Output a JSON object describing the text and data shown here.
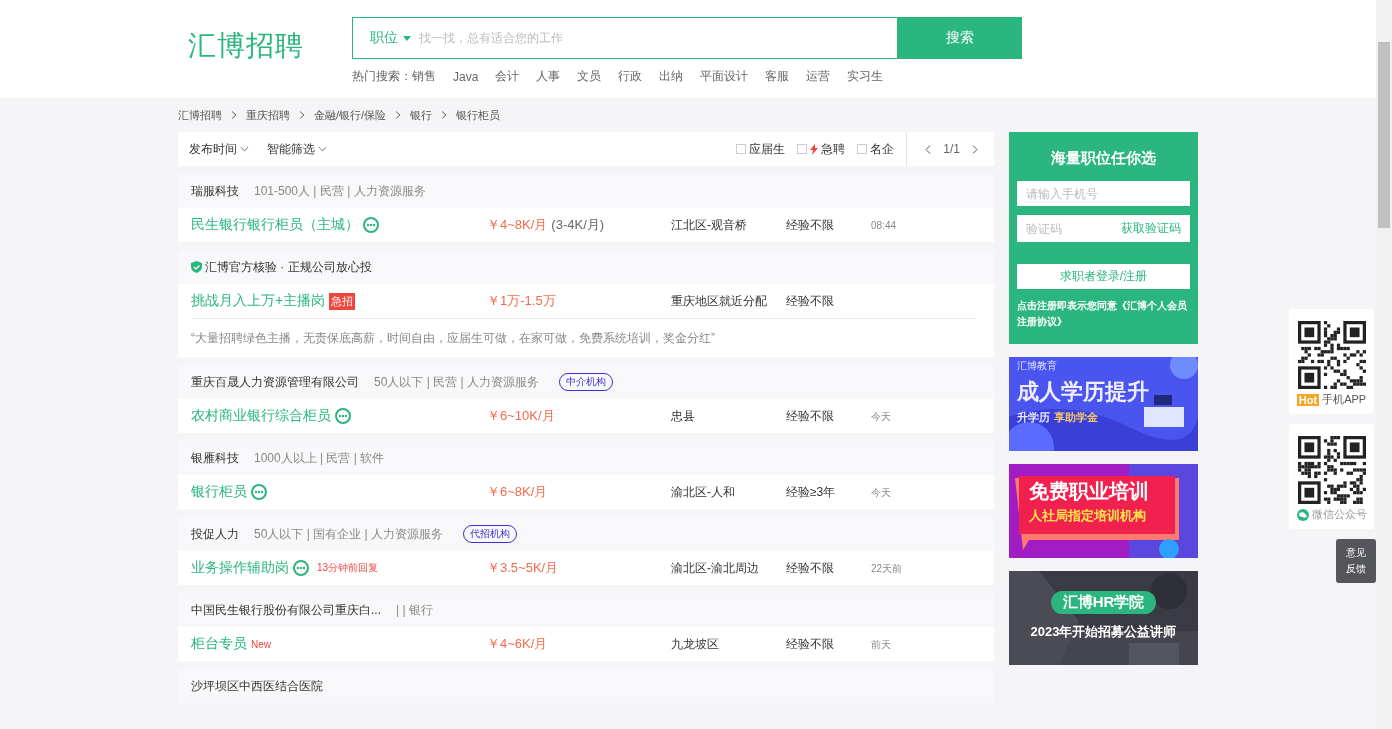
{
  "logo": "汇博招聘",
  "search": {
    "category": "职位",
    "placeholder": "找一找，总有适合您的工作",
    "button": "搜索"
  },
  "hot_search": {
    "label": "热门搜索：",
    "items": [
      "销售",
      "Java",
      "会计",
      "人事",
      "文员",
      "行政",
      "出纳",
      "平面设计",
      "客服",
      "运营",
      "实习生"
    ]
  },
  "breadcrumb": [
    "汇博招聘",
    "重庆招聘",
    "金融/银行/保险",
    "银行",
    "银行柜员"
  ],
  "filters": {
    "dropdowns": [
      "发布时间",
      "智能筛选"
    ],
    "checkboxes": [
      {
        "label": "应届生",
        "checked": false,
        "icon": false
      },
      {
        "label": "急聘",
        "checked": false,
        "icon": true
      },
      {
        "label": "名企",
        "checked": false,
        "icon": false
      }
    ],
    "pager": "1/1"
  },
  "listings": [
    {
      "kind": "job",
      "company": "瑞服科技",
      "info": "101-500人 | 民营 | 人力资源服务",
      "title": "民生银行银行柜员（主城）",
      "chat": true,
      "salary": "￥4~8K/月",
      "salary_note": "(3-4K/月)",
      "location": "江北区-观音桥",
      "experience": "经验不限",
      "time": "08:44"
    },
    {
      "kind": "promo",
      "header": "汇博官方核验 · 正规公司放心投",
      "title": "挑战月入上万+主播岗",
      "badge": {
        "kind": "urgent",
        "text": "急招"
      },
      "salary": "￥1万-1.5万",
      "location": "重庆地区就近分配",
      "experience": "经验不限",
      "quote": "“大量招聘绿色主播，无责保底高薪，时间自由，应届生可做，在家可做，免费系统培训，奖金分红”"
    },
    {
      "kind": "job",
      "company": "重庆百晟人力资源管理有限公司",
      "info": "50人以下 | 民营 | 人力资源服务",
      "tag": "中介机构",
      "title": "农村商业银行综合柜员",
      "chat": true,
      "salary": "￥6~10K/月",
      "location": "忠县",
      "experience": "经验不限",
      "time": "今天"
    },
    {
      "kind": "job",
      "company": "银雁科技",
      "info": "1000人以上 | 民营 | 软件",
      "title": "银行柜员",
      "chat": true,
      "salary": "￥6~8K/月",
      "location": "渝北区-人和",
      "experience": "经验≥3年",
      "time": "今天"
    },
    {
      "kind": "job",
      "company": "投促人力",
      "info": "50人以下 | 国有企业 | 人力资源服务",
      "tag": "代招机构",
      "title": "业务操作辅助岗",
      "chat": true,
      "reply": "13分钟前回复",
      "salary": "￥3.5~5K/月",
      "location": "渝北区-渝北周边",
      "experience": "经验不限",
      "time": "22天前"
    },
    {
      "kind": "job",
      "company": "中国民生银行股份有限公司重庆白...",
      "info": "| | 银行",
      "title": "柜台专员",
      "chat": false,
      "badge": {
        "kind": "new",
        "text": "New"
      },
      "salary": "￥4~6K/月",
      "location": "九龙坡区",
      "experience": "经验不限",
      "time": "前天"
    },
    {
      "kind": "company_only",
      "company": "沙坪坝区中西医结合医院"
    }
  ],
  "login": {
    "title": "海量职位任你选",
    "phone_placeholder": "请输入手机号",
    "code_placeholder": "验证码",
    "code_link": "获取验证码",
    "button": "求职者登录/注册",
    "agreement": "点击注册即表示您同意《汇博个人会员注册协议》"
  },
  "banners": [
    {
      "kind": "education",
      "tag": "汇博教育",
      "headline": "成人学历提升",
      "sub1": "升学历",
      "sub2": "享助学金"
    },
    {
      "kind": "training",
      "headline": "免费职业培训",
      "sub1": "人社局指定培训机构"
    },
    {
      "kind": "academy",
      "headline": "汇博HR学院",
      "sub1": "2023年开始招募公益讲师"
    }
  ],
  "float_panel": {
    "app": {
      "badge": "Hot",
      "label": "手机APP"
    },
    "wechat": {
      "label": "微信公众号"
    },
    "feedback": "意见反馈"
  }
}
